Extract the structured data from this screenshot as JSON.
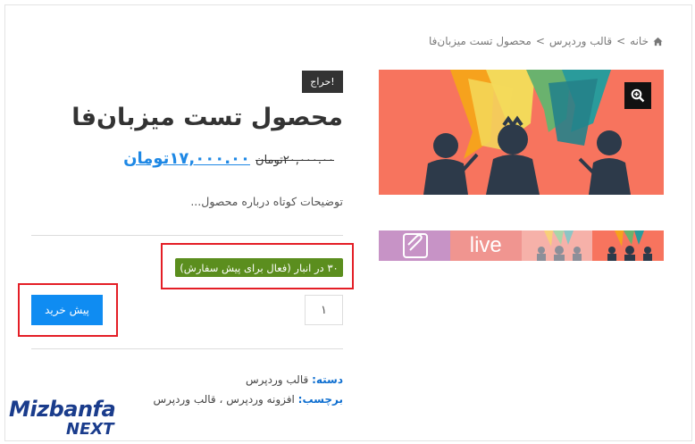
{
  "breadcrumb": {
    "home": "خانه",
    "sep1": ">",
    "category": "قالب وردپرس",
    "sep2": ">",
    "current": "محصول تست میزبان‌فا"
  },
  "product": {
    "sale_badge": "حراج!",
    "title": "محصول تست میزبان‌فا",
    "old_price": "۲۰,۰۰۰.۰۰تومان",
    "new_price": "۱۷,۰۰۰.۰۰تومان",
    "short_description": "توضیحات کوتاه درباره محصول...",
    "stock": "۳۰ در انبار (فعال برای پیش سفارش)",
    "quantity": "۱",
    "buy_button": "پیش خرید"
  },
  "meta": {
    "category_label": "دسته:",
    "category_value": "قالب وردپرس",
    "tag_label": "برچسب:",
    "tag_value_1": "افزونه وردپرس",
    "tag_comma": "،",
    "tag_value_2": "قالب وردپرس"
  },
  "gallery": {
    "thumb2_text": "live"
  },
  "logo": {
    "line1": "Mizbanfa",
    "line2": "NEXT"
  },
  "colors": {
    "accent_blue": "#0f8cf2",
    "stock_green": "#5b8e1e",
    "highlight_red": "#e41e26",
    "image_coral": "#f7745e"
  },
  "icons": [
    "home-icon",
    "zoom-icon"
  ]
}
